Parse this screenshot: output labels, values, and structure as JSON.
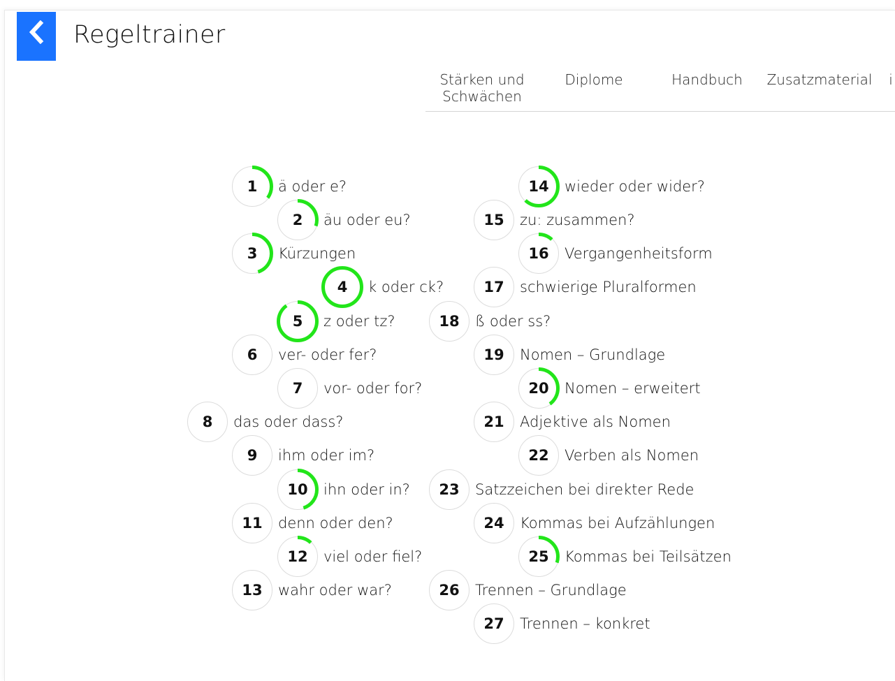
{
  "app": {
    "title": "Regeltrainer",
    "back_icon": "chevron-left-icon"
  },
  "nav": {
    "items": [
      {
        "label": "Stärken und\nSchwächen"
      },
      {
        "label": "Diplome"
      },
      {
        "label": "Handbuch"
      },
      {
        "label": "Zusatzmaterial"
      },
      {
        "label": "i"
      }
    ]
  },
  "colors": {
    "accent": "#1a73ff",
    "progress": "#22e51a",
    "ring": "#dcdcdc"
  },
  "lessons": [
    {
      "num": "1",
      "label": "ä oder e?",
      "progress": 0.35
    },
    {
      "num": "2",
      "label": "äu oder eu?",
      "progress": 0.3
    },
    {
      "num": "3",
      "label": "Kürzungen",
      "progress": 0.45
    },
    {
      "num": "4",
      "label": "k oder ck?",
      "progress": 1.0
    },
    {
      "num": "5",
      "label": "z oder tz?",
      "progress": 0.9
    },
    {
      "num": "6",
      "label": "ver- oder fer?",
      "progress": 0
    },
    {
      "num": "7",
      "label": "vor- oder for?",
      "progress": 0
    },
    {
      "num": "8",
      "label": "das oder dass?",
      "progress": 0
    },
    {
      "num": "9",
      "label": "ihm oder im?",
      "progress": 0
    },
    {
      "num": "10",
      "label": "ihn oder in?",
      "progress": 0.45
    },
    {
      "num": "11",
      "label": "denn oder den?",
      "progress": 0
    },
    {
      "num": "12",
      "label": "viel oder fiel?",
      "progress": 0.12
    },
    {
      "num": "13",
      "label": "wahr oder war?",
      "progress": 0
    },
    {
      "num": "14",
      "label": "wieder oder wider?",
      "progress": 0.62
    },
    {
      "num": "15",
      "label": "zu: zusammen?",
      "progress": 0
    },
    {
      "num": "16",
      "label": "Vergangenheitsform",
      "progress": 0.12
    },
    {
      "num": "17",
      "label": "schwierige Pluralformen",
      "progress": 0
    },
    {
      "num": "18",
      "label": "ß oder ss?",
      "progress": 0
    },
    {
      "num": "19",
      "label": "Nomen – Grundlage",
      "progress": 0
    },
    {
      "num": "20",
      "label": "Nomen – erweitert",
      "progress": 0.4
    },
    {
      "num": "21",
      "label": "Adjektive als Nomen",
      "progress": 0
    },
    {
      "num": "22",
      "label": "Verben als Nomen",
      "progress": 0
    },
    {
      "num": "23",
      "label": "Satzzeichen bei direkter Rede",
      "progress": 0
    },
    {
      "num": "24",
      "label": "Kommas bei Aufzählungen",
      "progress": 0
    },
    {
      "num": "25",
      "label": "Kommas bei Teilsätzen",
      "progress": 0.3
    },
    {
      "num": "26",
      "label": "Trennen – Grundlage",
      "progress": 0
    },
    {
      "num": "27",
      "label": "Trennen – konkret",
      "progress": 0
    }
  ]
}
